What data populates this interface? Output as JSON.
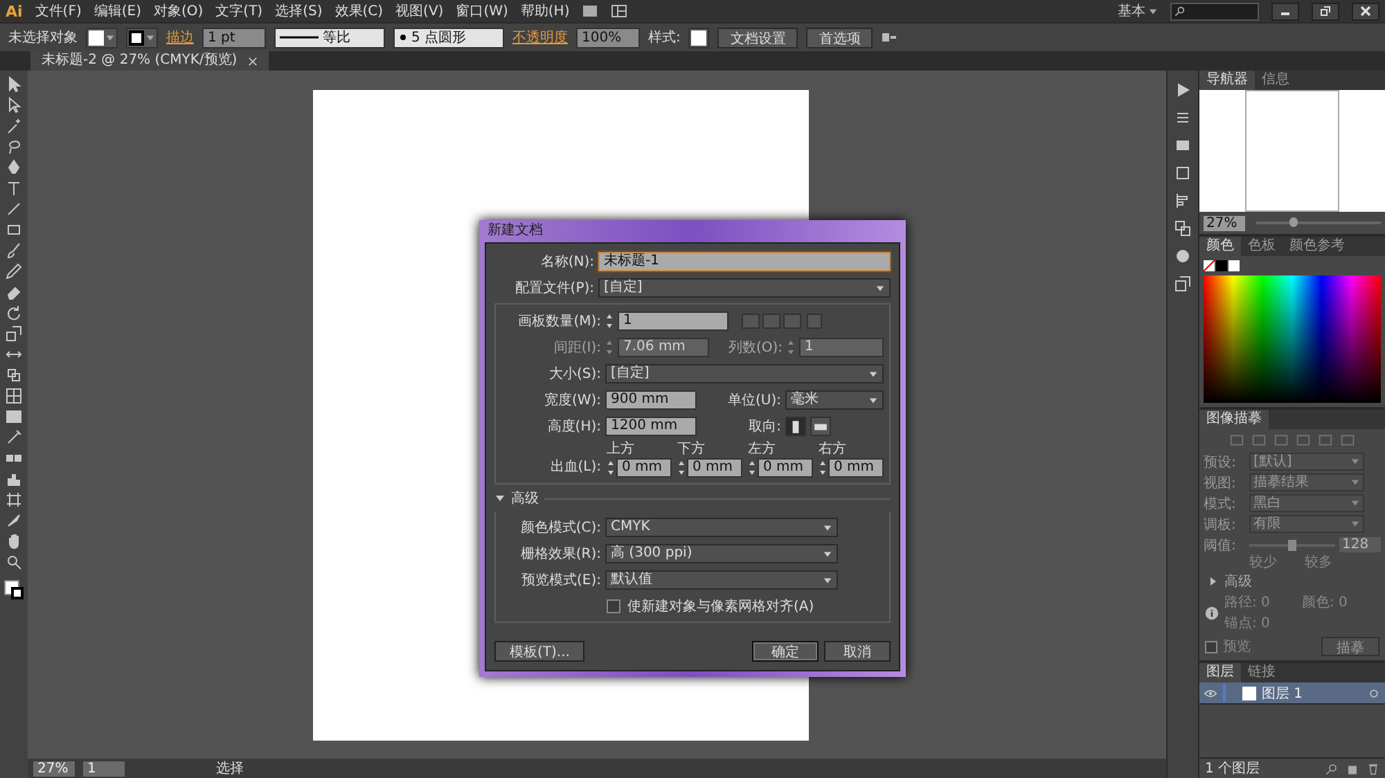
{
  "menu_bar": {
    "logo": "Ai",
    "items": [
      "文件(F)",
      "编辑(E)",
      "对象(O)",
      "文字(T)",
      "选择(S)",
      "效果(C)",
      "视图(V)",
      "窗口(W)",
      "帮助(H)"
    ],
    "workspace": "基本"
  },
  "control_bar": {
    "selection": "未选择对象",
    "stroke_label": "描边",
    "stroke_weight": "1 pt",
    "stroke_profile": "等比",
    "brush": "5 点圆形",
    "opacity_label": "不透明度",
    "opacity": "100%",
    "style_label": "样式:",
    "buttons": [
      "文档设置",
      "首选项"
    ]
  },
  "document_tab": {
    "title": "未标题-2 @ 27% (CMYK/预览)"
  },
  "dialog": {
    "title": "新建文档",
    "name": {
      "label": "名称(N):",
      "value": "未标题-1"
    },
    "profile": {
      "label": "配置文件(P):",
      "value": "[自定]"
    },
    "artboards": {
      "label": "画板数量(M):",
      "value": "1",
      "disabled": false
    },
    "spacing": {
      "label": "间距(I):",
      "value": "7.06 mm",
      "disabled": true
    },
    "columns": {
      "label": "列数(O):",
      "value": "1",
      "disabled": true
    },
    "size": {
      "label": "大小(S):",
      "value": "[自定]"
    },
    "width": {
      "label": "宽度(W):",
      "value": "900 mm"
    },
    "units": {
      "label": "单位(U):",
      "value": "毫米"
    },
    "height": {
      "label": "高度(H):",
      "value": "1200 mm"
    },
    "orientation": {
      "label": "取向:",
      "options": [
        {
          "kind": "portrait",
          "selected": true
        },
        {
          "kind": "landscape",
          "selected": false
        }
      ]
    },
    "bleed": {
      "label": "出血(L):",
      "sides": [
        {
          "label": "上方",
          "value": "0 mm"
        },
        {
          "label": "下方",
          "value": "0 mm"
        },
        {
          "label": "左方",
          "value": "0 mm"
        },
        {
          "label": "右方",
          "value": "0 mm"
        }
      ]
    },
    "advanced": {
      "label": "高级",
      "expanded": true,
      "fields": [
        {
          "label": "颜色模式(C):",
          "value": "CMYK"
        },
        {
          "label": "栅格效果(R):",
          "value": "高 (300 ppi)"
        },
        {
          "label": "预览模式(E):",
          "value": "默认值"
        }
      ],
      "checkbox": {
        "label": "使新建对象与像素网格对齐(A)",
        "checked": false
      }
    },
    "buttons": [
      {
        "label": "模板(T)...",
        "kind": "secondary"
      },
      {
        "label": "确定",
        "kind": "default"
      },
      {
        "label": "取消",
        "kind": "secondary"
      }
    ]
  },
  "navigator": {
    "tabs": [
      {
        "label": "导航器",
        "selected": true
      },
      {
        "label": "信息",
        "selected": false
      }
    ],
    "zoom": "27%",
    "zoom_slider": {
      "level": 0.3
    }
  },
  "color_panel": {
    "tabs": [
      {
        "label": "颜色",
        "selected": true
      },
      {
        "label": "色板",
        "selected": false
      },
      {
        "label": "颜色参考",
        "selected": false
      }
    ]
  },
  "image_trace": {
    "title": "图像描摹",
    "fields": [
      {
        "label": "预设:",
        "value": "[默认]"
      },
      {
        "label": "视图:",
        "value": "描摹结果"
      },
      {
        "label": "模式:",
        "value": "黑白"
      },
      {
        "label": "调板:",
        "value": "有限"
      }
    ],
    "threshold": {
      "label": "阈值:",
      "level": 0.5,
      "value": "128",
      "min_label": "较少",
      "max_label": "较多"
    },
    "advanced": {
      "label": "高级",
      "expanded": false
    },
    "stats": [
      {
        "label": "路径:",
        "value": "0"
      },
      {
        "label": "颜色:",
        "value": "0"
      },
      {
        "label": "锚点:",
        "value": "0"
      }
    ],
    "preview": {
      "label": "预览",
      "checked": false
    },
    "button": "描摹"
  },
  "layers": {
    "tabs": [
      {
        "label": "图层",
        "selected": true
      },
      {
        "label": "链接",
        "selected": false
      }
    ],
    "rows": [
      {
        "name": "图层 1",
        "selected": true
      }
    ],
    "count": "1 个图层"
  },
  "status_bar": {
    "zoom": "27%",
    "artboard": "1",
    "tool": "选择"
  }
}
